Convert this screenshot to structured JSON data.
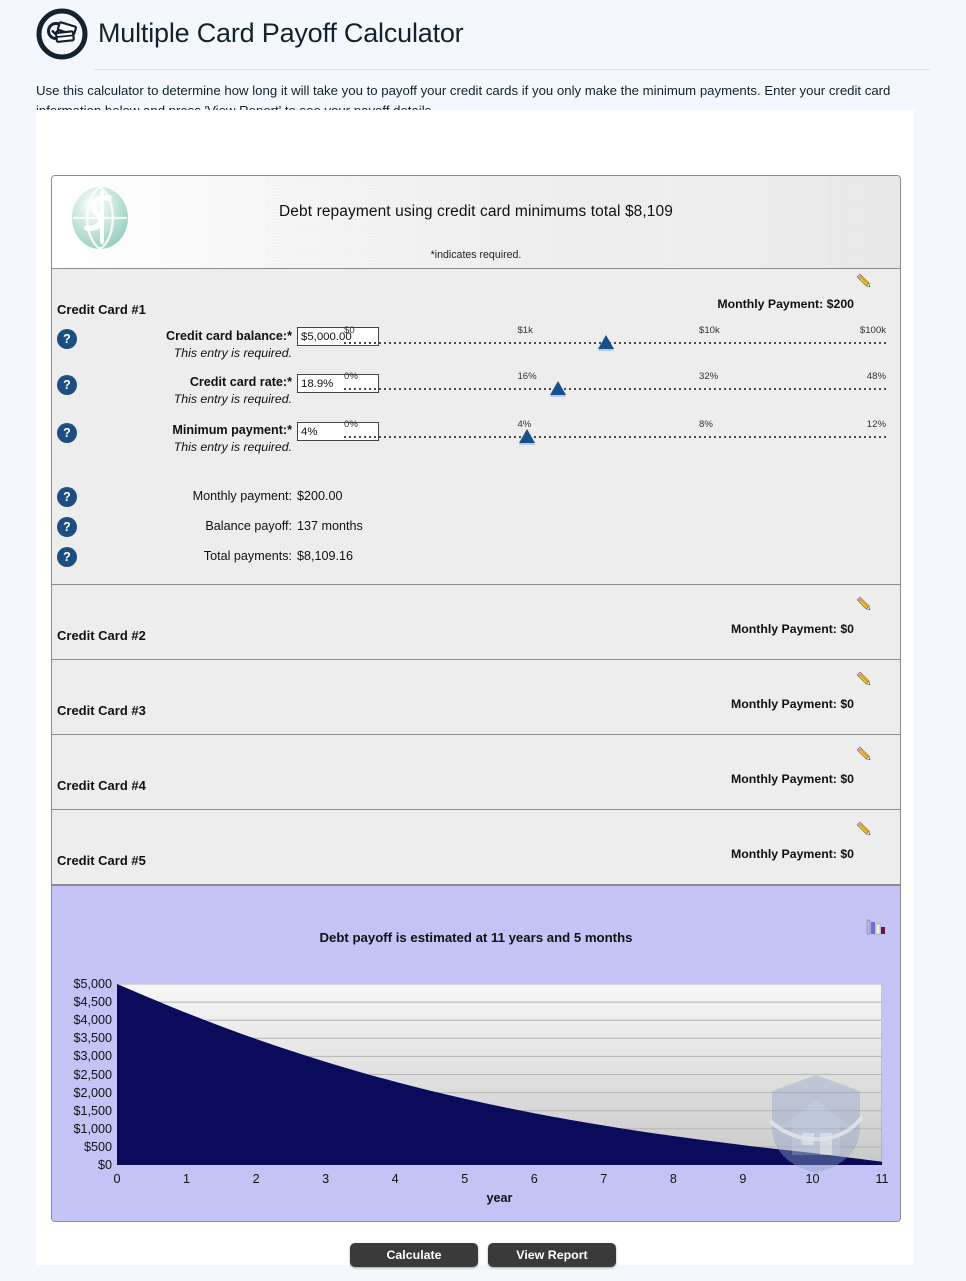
{
  "page": {
    "title": "Multiple Card Payoff Calculator",
    "intro": "Use this calculator to determine how long it will take you to payoff your credit cards if you only make the minimum payments. Enter your credit card information below and press 'View Report' to see your payoff details.",
    "background_color": "#f4f8fc"
  },
  "calculator": {
    "header_title": "Debt repayment using credit card minimums total $8,109",
    "required_note": "*indicates required.",
    "accent_color": "#1c4e80"
  },
  "card1": {
    "title": "Credit Card #1",
    "monthly_payment_label": "Monthly Payment: $200",
    "fields": [
      {
        "label": "Credit card balance:*",
        "note": "This entry is required.",
        "value": "$5,000.00",
        "ticks": [
          "$0",
          "$1k",
          "$10k",
          "$100k"
        ],
        "thumb_percent": 48
      },
      {
        "label": "Credit card rate:*",
        "note": "This entry is required.",
        "value": "18.9%",
        "ticks": [
          "0%",
          "16%",
          "32%",
          "48%"
        ],
        "thumb_percent": 39
      },
      {
        "label": "Minimum payment:*",
        "note": "This entry is required.",
        "value": "4%",
        "ticks": [
          "0%",
          "4%",
          "8%",
          "12%"
        ],
        "thumb_percent": 33
      }
    ],
    "results": [
      {
        "label": "Monthly payment:",
        "value": "$200.00"
      },
      {
        "label": "Balance payoff:",
        "value": "137 months"
      },
      {
        "label": "Total payments:",
        "value": "$8,109.16"
      }
    ]
  },
  "other_cards": [
    {
      "title": "Credit Card #2",
      "monthly_payment_label": "Monthly Payment: $0"
    },
    {
      "title": "Credit Card #3",
      "monthly_payment_label": "Monthly Payment: $0"
    },
    {
      "title": "Credit Card #4",
      "monthly_payment_label": "Monthly Payment: $0"
    },
    {
      "title": "Credit Card #5",
      "monthly_payment_label": "Monthly Payment: $0"
    }
  ],
  "chart_data": {
    "type": "area",
    "title": "Debt payoff is estimated at 11 years and 5 months",
    "xlabel": "year",
    "ylabel": "",
    "x": [
      0,
      1,
      2,
      3,
      4,
      5,
      6,
      7,
      8,
      9,
      10,
      11
    ],
    "values": [
      5000,
      4200,
      3480,
      2850,
      2300,
      1830,
      1430,
      1090,
      800,
      550,
      330,
      90
    ],
    "xtick_labels": [
      "0",
      "1",
      "2",
      "3",
      "4",
      "5",
      "6",
      "7",
      "8",
      "9",
      "10",
      "11"
    ],
    "ytick_labels": [
      "$5,000",
      "$4,500",
      "$4,000",
      "$3,500",
      "$3,000",
      "$2,500",
      "$2,000",
      "$1,500",
      "$1,000",
      "$500",
      "$0"
    ],
    "ytick_values": [
      5000,
      4500,
      4000,
      3500,
      3000,
      2500,
      2000,
      1500,
      1000,
      500,
      0
    ],
    "xlim": [
      0,
      11
    ],
    "ylim": [
      0,
      5000
    ],
    "grid": true,
    "legend": "none",
    "series_color": "#0b0b5c",
    "plot_background": "#c3c4f5"
  },
  "buttons": {
    "calculate": "Calculate",
    "view_report": "View Report"
  }
}
